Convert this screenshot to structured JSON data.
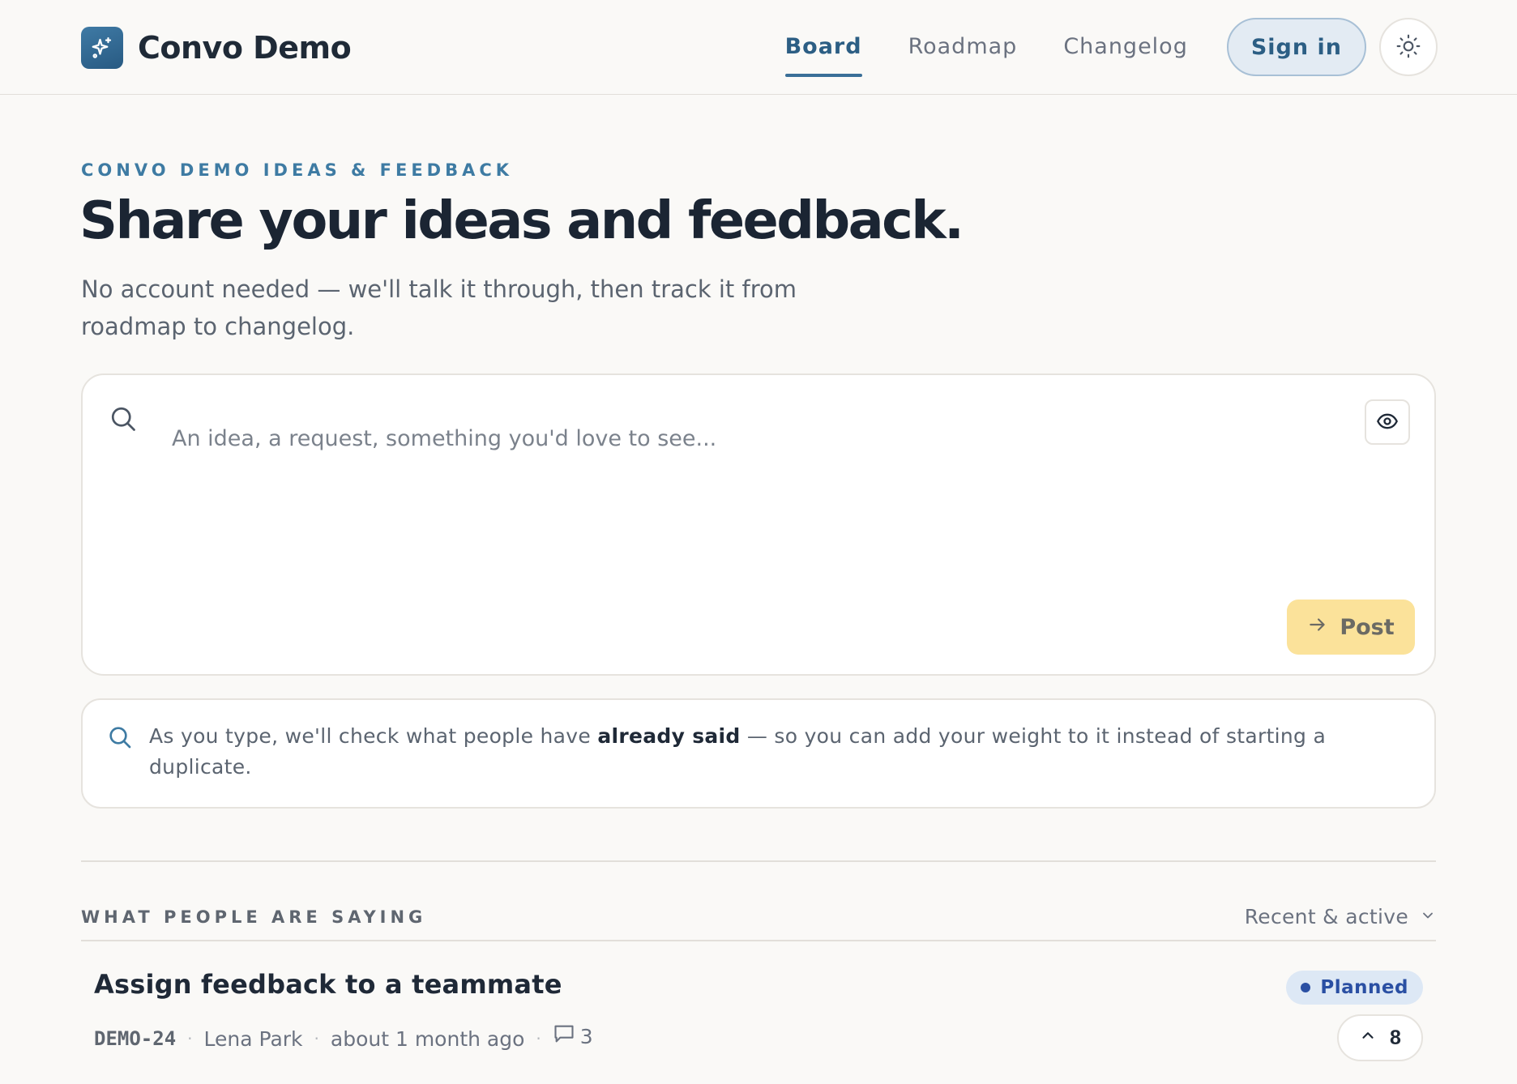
{
  "header": {
    "brand_name": "Convo Demo",
    "brand_icon": "sparkles-icon",
    "nav": [
      {
        "label": "Board",
        "active": true
      },
      {
        "label": "Roadmap",
        "active": false
      },
      {
        "label": "Changelog",
        "active": false
      }
    ],
    "signin_label": "Sign in",
    "theme_icon": "sun-icon"
  },
  "hero": {
    "eyebrow": "CONVO DEMO IDEAS & FEEDBACK",
    "title": "Share your ideas and feedback.",
    "subtitle": "No account needed — we'll talk it through, then track it from roadmap to changelog."
  },
  "composer": {
    "placeholder": "An idea, a request, something you'd love to see...",
    "value": "",
    "post_label": "Post"
  },
  "hint": {
    "before": "As you type, we'll check what people have ",
    "bold": "already said",
    "after": " — so you can add your weight to it instead of starting a duplicate."
  },
  "list": {
    "label": "WHAT PEOPLE ARE SAYING",
    "sort_label": "Recent & active",
    "items": [
      {
        "title": "Assign feedback to a teammate",
        "status": "Planned",
        "id": "DEMO-24",
        "author": "Lena Park",
        "time": "about 1 month ago",
        "comments": "3",
        "votes": "8"
      }
    ]
  },
  "colors": {
    "accent": "#2c5e84",
    "post_button": "#fbe29a",
    "status_planned": "#2a4fa3",
    "background": "#faf9f7"
  }
}
